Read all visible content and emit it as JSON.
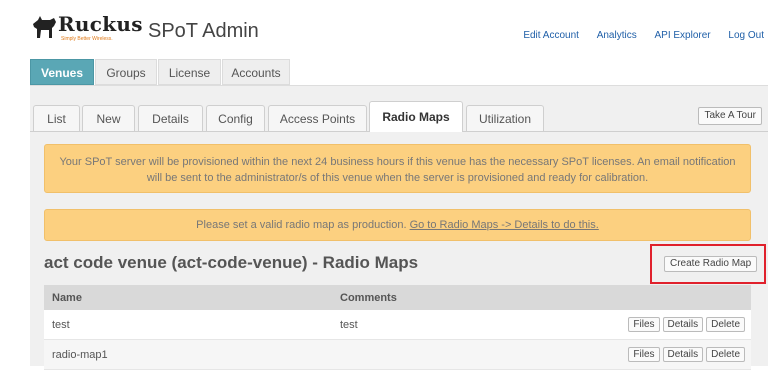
{
  "brand": {
    "logo_word": "Ruckus",
    "logo_tagline": "Simply Better Wireless.",
    "app_title": "SPoT Admin"
  },
  "top_links": [
    "Edit Account",
    "Analytics",
    "API Explorer",
    "Log Out"
  ],
  "main_nav": [
    "Venues",
    "Groups",
    "License",
    "Accounts"
  ],
  "sub_tabs": [
    "List",
    "New",
    "Details",
    "Config",
    "Access Points",
    "Radio Maps",
    "Utilization"
  ],
  "active_sub_tab": "Radio Maps",
  "tour_button": "Take A Tour",
  "notices": {
    "provision_line1": "Your SPoT server will be provisioned within the next 24 business hours if this venue has the necessary SPoT licenses. An email notification",
    "provision_line2": "will be sent to the administrator/s of this venue when the server is provisioned and ready for calibration.",
    "radio_map_text": "Please set a valid radio map as production.",
    "radio_map_link": "Go to Radio Maps -> Details to do this."
  },
  "section_title": "act code venue (act-code-venue) - Radio Maps",
  "create_button": "Create Radio Map",
  "table": {
    "headers": {
      "name": "Name",
      "comments": "Comments"
    },
    "rows": [
      {
        "name": "test",
        "comments": "test"
      },
      {
        "name": "radio-map1",
        "comments": ""
      }
    ],
    "actions": [
      "Files",
      "Details",
      "Delete"
    ]
  },
  "colors": {
    "active_tab": "#5aa7b5",
    "notice_bg": "#fcd080",
    "highlight_border": "#e0212c",
    "link": "#1f5fa8"
  }
}
